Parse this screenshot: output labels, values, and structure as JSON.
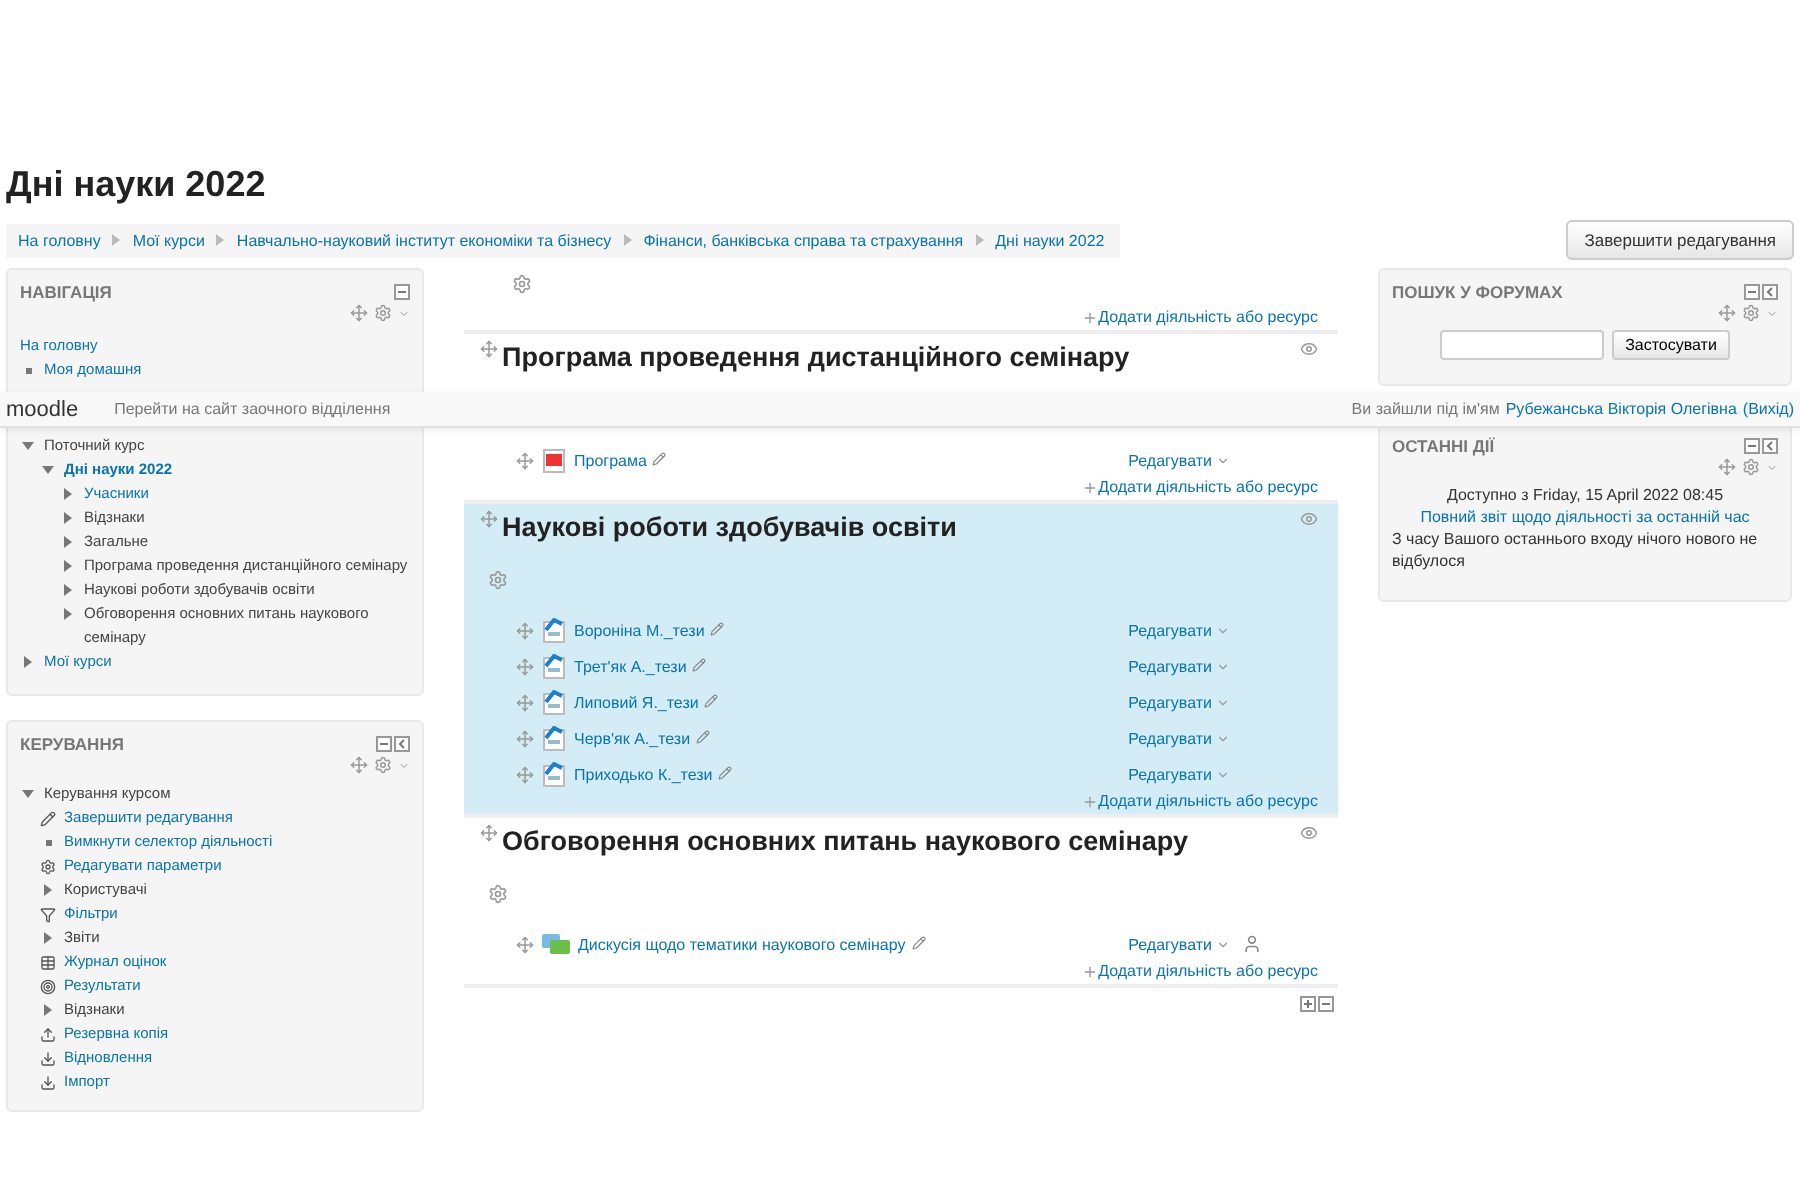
{
  "page_title": "Дні науки 2022",
  "breadcrumb": [
    "На головну",
    "Мої курси",
    "Навчально-науковий інститут економіки та бізнесу",
    "Фінанси, банківська справа та страхування",
    "Дні науки 2022"
  ],
  "edit_button": "Завершити редагування",
  "navbar": {
    "brand": "moodle",
    "link": "Перейти на сайт заочного відділення",
    "login_text": "Ви зайшли під ім'ям",
    "user": "Рубежанська Вікторія Олегівна",
    "logout": "(Вихід)"
  },
  "navigation": {
    "title": "НАВІГАЦІЯ",
    "dock_icon": false,
    "items": [
      {
        "label": "На головну",
        "kind": "none",
        "link": true
      },
      {
        "label": "Моя домашня",
        "kind": "bullet",
        "link": true
      },
      {
        "label": "Поточний курс",
        "kind": "branch",
        "link": false,
        "expanded": true,
        "children": [
          {
            "label": "Дні науки 2022",
            "kind": "branch",
            "link": true,
            "current": true,
            "expanded": true,
            "children": [
              {
                "label": "Учасники",
                "kind": "branch",
                "link": true,
                "expanded": false
              },
              {
                "label": "Відзнаки",
                "kind": "branch",
                "link": false,
                "expanded": false
              },
              {
                "label": "Загальне",
                "kind": "branch",
                "link": false,
                "expanded": false
              },
              {
                "label": "Програма проведення дистанційного семінару",
                "kind": "branch",
                "link": false,
                "expanded": false
              },
              {
                "label": "Наукові роботи здобувачів освіти",
                "kind": "branch",
                "link": false,
                "expanded": false
              },
              {
                "label": "Обговорення основних питань наукового семінару",
                "kind": "branch",
                "link": false,
                "expanded": false
              }
            ]
          }
        ]
      },
      {
        "label": "Мої курси",
        "kind": "branch",
        "link": true,
        "expanded": false
      }
    ]
  },
  "administration": {
    "title": "КЕРУВАННЯ",
    "dock_icon": true,
    "items": [
      {
        "label": "Керування курсом",
        "kind": "branch",
        "link": false,
        "expanded": true,
        "children": [
          {
            "label": "Завершити редагування",
            "kind": "pencil",
            "link": true
          },
          {
            "label": "Вимкнути селектор діяльності",
            "kind": "bullet",
            "link": true
          },
          {
            "label": "Редагувати параметри",
            "kind": "gear",
            "link": true
          },
          {
            "label": "Користувачі",
            "kind": "branch",
            "link": false,
            "expanded": false
          },
          {
            "label": "Фільтри",
            "kind": "filter",
            "link": true
          },
          {
            "label": "Звіти",
            "kind": "branch",
            "link": false,
            "expanded": false
          },
          {
            "label": "Журнал оцінок",
            "kind": "table",
            "link": true
          },
          {
            "label": "Результати",
            "kind": "results",
            "link": true
          },
          {
            "label": "Відзнаки",
            "kind": "branch",
            "link": false,
            "expanded": false
          },
          {
            "label": "Резервна копія",
            "kind": "upload",
            "link": true
          },
          {
            "label": "Відновлення",
            "kind": "restore",
            "link": true
          },
          {
            "label": "Імпорт",
            "kind": "import",
            "link": true
          }
        ]
      }
    ]
  },
  "sections": [
    {
      "current": false,
      "add_link": "Додати діяльність або ресурс"
    },
    {
      "title": "Програма проведення дистанційного семінару",
      "current": false,
      "activities": [
        {
          "name": "Програма",
          "kind": "pdf",
          "edit": "Редагувати",
          "user_icon": false
        }
      ],
      "add_link": "Додати діяльність або ресурс"
    },
    {
      "title": "Наукові роботи здобувачів освіти",
      "current": true,
      "activities": [
        {
          "name": "Вороніна М._тези",
          "kind": "assignment",
          "edit": "Редагувати",
          "user_icon": false
        },
        {
          "name": "Трет'як А._тези",
          "kind": "assignment",
          "edit": "Редагувати",
          "user_icon": false
        },
        {
          "name": "Липовий Я._тези",
          "kind": "assignment",
          "edit": "Редагувати",
          "user_icon": false
        },
        {
          "name": "Черв'як А._тези",
          "kind": "assignment",
          "edit": "Редагувати",
          "user_icon": false
        },
        {
          "name": "Приходько К._тези",
          "kind": "assignment",
          "edit": "Редагувати",
          "user_icon": false
        }
      ],
      "add_link": "Додати діяльність або ресурс"
    },
    {
      "title": "Обговорення основних питань наукового семінару",
      "current": false,
      "activities": [
        {
          "name": "Дискусія щодо тематики наукового семінару",
          "kind": "forum",
          "edit": "Редагувати",
          "user_icon": true
        }
      ],
      "add_link": "Додати діяльність або ресурс"
    }
  ],
  "forum_search": {
    "title": "ПОШУК У ФОРУМАХ",
    "dock_icon": true,
    "button": "Застосувати"
  },
  "recent_activity": {
    "title": "ОСТАННІ ДІЇ",
    "dock_icon": true,
    "since": "Доступно з Friday, 15 April 2022 08:45",
    "report_link": "Повний звіт щодо діяльності за останній час",
    "message": "З часу Вашого останнього входу нічого нового не відбулося"
  }
}
